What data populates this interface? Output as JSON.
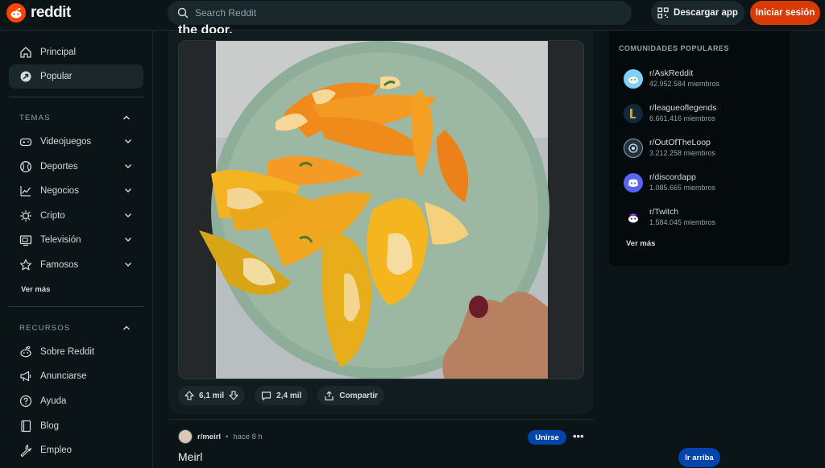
{
  "header": {
    "logo_text": "reddit",
    "search_placeholder": "Search Reddit",
    "app_button": "Descargar app",
    "login_button": "Iniciar sesión"
  },
  "sidebar": {
    "main": [
      {
        "label": "Principal",
        "icon": "home-icon"
      },
      {
        "label": "Popular",
        "icon": "popular-icon",
        "active": true
      }
    ],
    "topics_title": "TEMAS",
    "topics": [
      {
        "label": "Videojuegos",
        "icon": "gamepad-icon"
      },
      {
        "label": "Deportes",
        "icon": "sports-icon"
      },
      {
        "label": "Negocios",
        "icon": "chart-icon"
      },
      {
        "label": "Cripto",
        "icon": "crypto-icon"
      },
      {
        "label": "Televisión",
        "icon": "tv-icon"
      },
      {
        "label": "Famosos",
        "icon": "star-icon"
      }
    ],
    "topics_more": "Ver más",
    "resources_title": "RECURSOS",
    "resources": [
      {
        "label": "Sobre Reddit",
        "icon": "reddit-icon"
      },
      {
        "label": "Anunciarse",
        "icon": "megaphone-icon"
      },
      {
        "label": "Ayuda",
        "icon": "help-icon"
      },
      {
        "label": "Blog",
        "icon": "book-icon"
      },
      {
        "label": "Empleo",
        "icon": "wrench-icon"
      }
    ]
  },
  "post": {
    "title_fragment": "the door.",
    "upvotes": "6,1 mil",
    "comments": "2,4 mil",
    "share_label": "Compartir"
  },
  "next_post": {
    "subreddit": "r/meirl",
    "time": "hace 8 h",
    "join_label": "Unirse",
    "title": "Meirl"
  },
  "scroll_top_label": "Ir arriba",
  "right_panel": {
    "title": "COMUNIDADES POPULARES",
    "communities": [
      {
        "name": "r/AskReddit",
        "members": "42.952.584 miembros",
        "color": "#7ed2f7"
      },
      {
        "name": "r/leagueoflegends",
        "members": "6.661.416 miembros",
        "color": "#0f2a3a"
      },
      {
        "name": "r/OutOfTheLoop",
        "members": "3.212.258 miembros",
        "color": "#1f3340"
      },
      {
        "name": "r/discordapp",
        "members": "1.085.665 miembros",
        "color": "#5865f2"
      },
      {
        "name": "r/Twitch",
        "members": "1.584.045 miembros",
        "color": "#050b0d"
      }
    ],
    "more": "Ver más"
  },
  "colors": {
    "background": "#0b1416",
    "accent_orange": "#d93a00",
    "join_blue": "#0045ac"
  }
}
